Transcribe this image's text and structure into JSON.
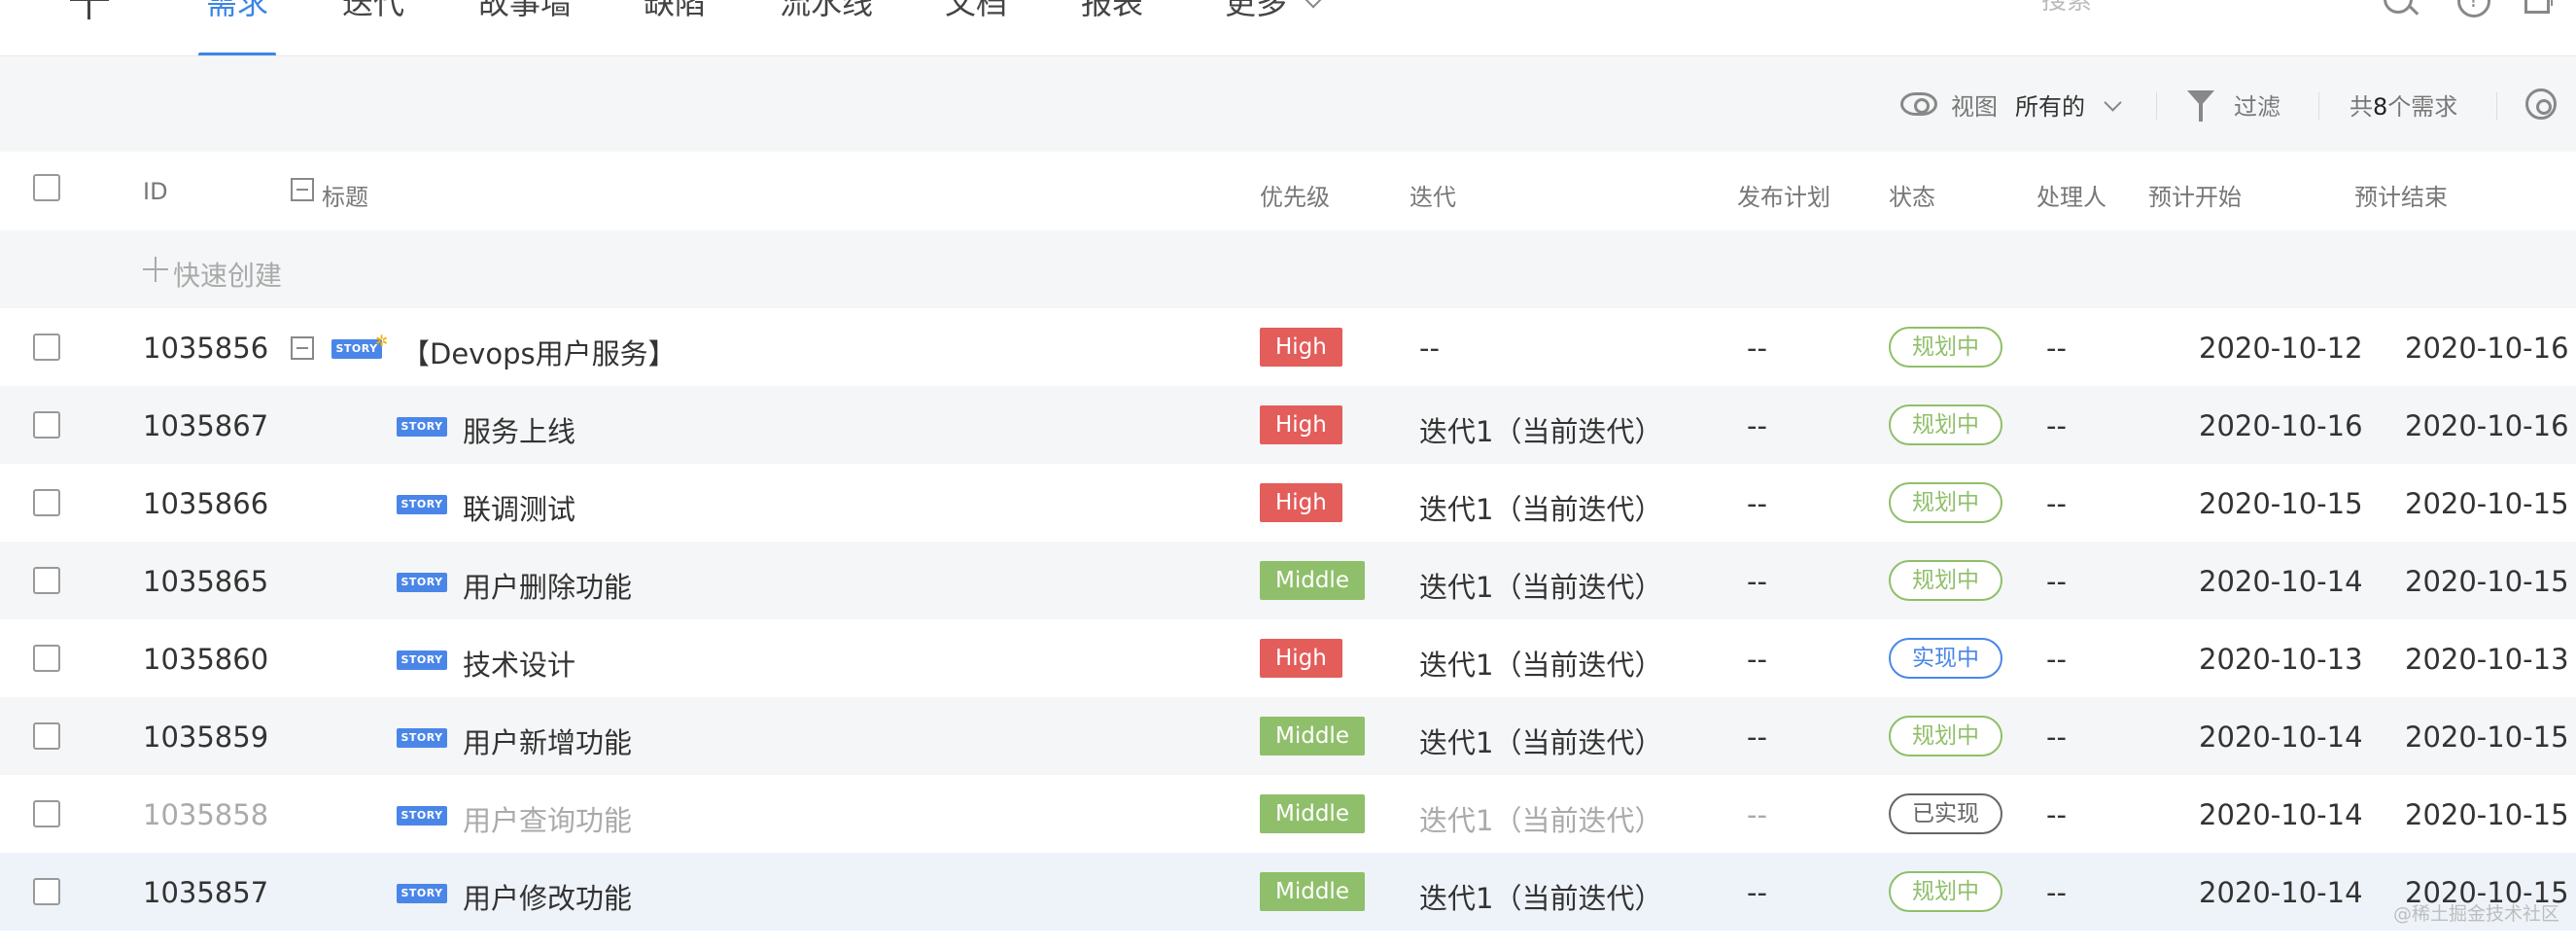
{
  "nav": {
    "tabs": [
      {
        "label": "需求",
        "active": true
      },
      {
        "label": "迭代"
      },
      {
        "label": "故事墙"
      },
      {
        "label": "缺陷"
      },
      {
        "label": "流水线"
      },
      {
        "label": "文档"
      },
      {
        "label": "报表"
      },
      {
        "label": "更多"
      }
    ],
    "search_placeholder": "搜索"
  },
  "toolbar": {
    "view_label": "视图",
    "view_value": "所有的",
    "filter_label": "过滤",
    "count_prefix": "共",
    "count_value": "8",
    "count_suffix": "个需求"
  },
  "table": {
    "headers": {
      "id": "ID",
      "title": "标题",
      "priority": "优先级",
      "iteration": "迭代",
      "release": "发布计划",
      "status": "状态",
      "assignee": "处理人",
      "start": "预计开始",
      "end": "预计结束"
    },
    "quick_create": "快速创建",
    "rows": [
      {
        "id": "1035856",
        "title": "【Devops用户服务】",
        "type": "STORY",
        "priority": "High",
        "iteration": "--",
        "release": "--",
        "status": "规划中",
        "assignee": "--",
        "start": "2020-10-12",
        "end": "2020-10-16",
        "parent": true
      },
      {
        "id": "1035867",
        "title": "服务上线",
        "type": "STORY",
        "priority": "High",
        "iteration": "迭代1（当前迭代）",
        "release": "--",
        "status": "规划中",
        "assignee": "--",
        "start": "2020-10-16",
        "end": "2020-10-16"
      },
      {
        "id": "1035866",
        "title": "联调测试",
        "type": "STORY",
        "priority": "High",
        "iteration": "迭代1（当前迭代）",
        "release": "--",
        "status": "规划中",
        "assignee": "--",
        "start": "2020-10-15",
        "end": "2020-10-15"
      },
      {
        "id": "1035865",
        "title": "用户删除功能",
        "type": "STORY",
        "priority": "Middle",
        "iteration": "迭代1（当前迭代）",
        "release": "--",
        "status": "规划中",
        "assignee": "--",
        "start": "2020-10-14",
        "end": "2020-10-15"
      },
      {
        "id": "1035860",
        "title": "技术设计",
        "type": "STORY",
        "priority": "High",
        "iteration": "迭代1（当前迭代）",
        "release": "--",
        "status": "实现中",
        "assignee": "--",
        "start": "2020-10-13",
        "end": "2020-10-13"
      },
      {
        "id": "1035859",
        "title": "用户新增功能",
        "type": "STORY",
        "priority": "Middle",
        "iteration": "迭代1（当前迭代）",
        "release": "--",
        "status": "规划中",
        "assignee": "--",
        "start": "2020-10-14",
        "end": "2020-10-15"
      },
      {
        "id": "1035858",
        "title": "用户查询功能",
        "type": "STORY",
        "priority": "Middle",
        "iteration": "迭代1（当前迭代）",
        "release": "--",
        "status": "已实现",
        "assignee": "--",
        "start": "2020-10-14",
        "end": "2020-10-15",
        "dim": true
      },
      {
        "id": "1035857",
        "title": "用户修改功能",
        "type": "STORY",
        "priority": "Middle",
        "iteration": "迭代1（当前迭代）",
        "release": "--",
        "status": "规划中",
        "assignee": "--",
        "start": "2020-10-14",
        "end": "2020-10-15",
        "selected": true
      }
    ]
  },
  "watermark": "@稀土掘金技术社区"
}
